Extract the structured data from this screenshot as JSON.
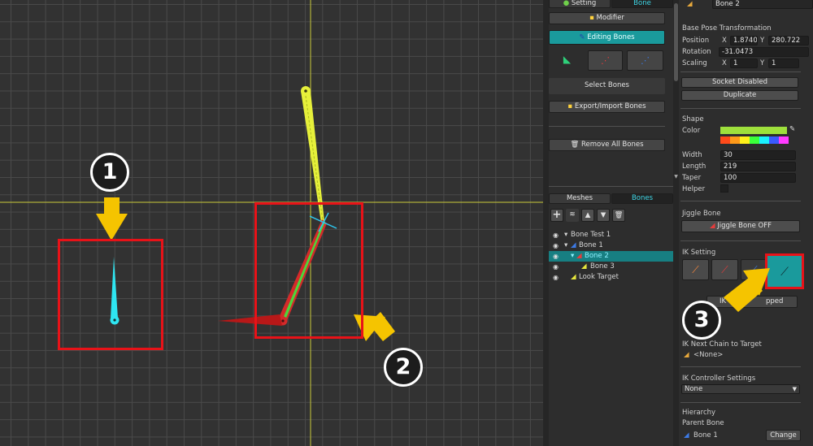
{
  "top_tabs": [
    "Setting",
    "Bone"
  ],
  "mid": {
    "modifier_label": "Modifier",
    "editing_bones_label": "Editing Bones",
    "select_bones_label": "Select Bones",
    "export_import_label": "Export/Import Bones",
    "remove_all_label": "Remove All Bones",
    "tabs": [
      "Meshes",
      "Bones"
    ],
    "tree": [
      {
        "label": "Bone Test 1"
      },
      {
        "label": "Bone 1"
      },
      {
        "label": "Bone 2"
      },
      {
        "label": "Bone 3"
      },
      {
        "label": "Look Target"
      }
    ]
  },
  "right": {
    "bone_name": "Bone 2",
    "base_pose_title": "Base Pose Transformation",
    "position_label": "Position",
    "position_x": "1.874033",
    "position_y": "280.722",
    "rotation_label": "Rotation",
    "rotation_value": "-31.0473",
    "scaling_label": "Scaling",
    "scaling_x": "1",
    "scaling_y": "1",
    "x_label": "X",
    "y_label": "Y",
    "socket_label": "Socket Disabled",
    "duplicate_label": "Duplicate",
    "shape_title": "Shape",
    "color_label": "Color",
    "width_label": "Width",
    "width_value": "30",
    "length_label": "Length",
    "length_value": "219",
    "taper_label": "Taper",
    "taper_value": "100",
    "helper_label": "Helper",
    "jiggle_title": "Jiggle Bone",
    "jiggle_button": "Jiggle Bone OFF",
    "ik_title": "IK Setting",
    "ik_partial_1": "IK",
    "ik_partial_2": "pped",
    "ik_next_chain_title": "IK Next Chain to Target",
    "ik_next_chain_value": "<None>",
    "ik_controller_title": "IK Controller Settings",
    "ik_controller_value": "None",
    "hierarchy_title": "Hierarchy",
    "parent_bone_title": "Parent Bone",
    "parent_bone_value": "Bone 1",
    "change_label": "Change"
  },
  "annotations": [
    "1",
    "2",
    "3"
  ],
  "colors": {
    "teal": "#1a9a9c",
    "annotation_red": "#e81218",
    "annotation_yellow": "#f5c400",
    "color_swatch": "#9ee03c"
  }
}
